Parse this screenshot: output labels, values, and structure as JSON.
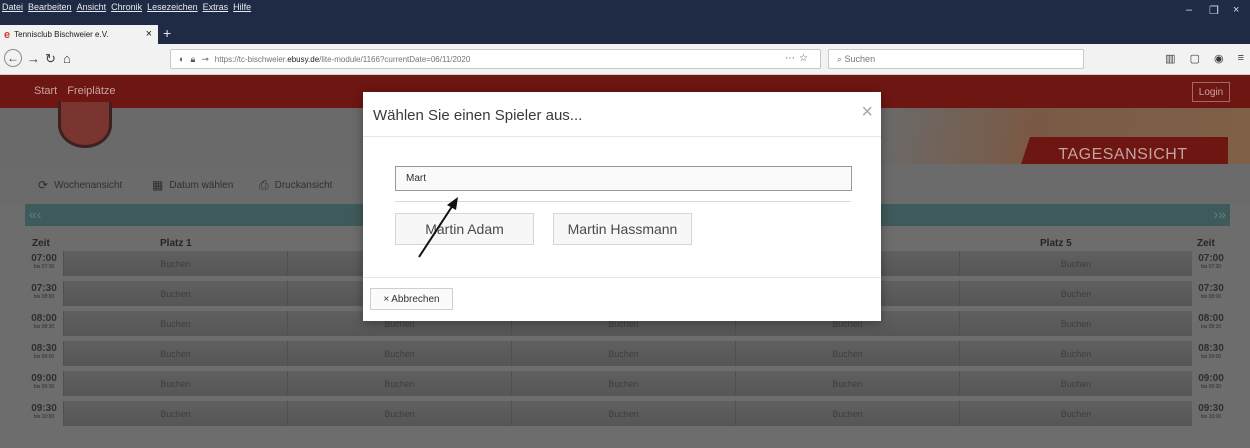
{
  "browser": {
    "menu": [
      "Datei",
      "Bearbeiten",
      "Ansicht",
      "Chronik",
      "Lesezeichen",
      "Extras",
      "Hilfe"
    ],
    "window_controls": [
      "–",
      "❐",
      "×"
    ],
    "tab": {
      "title": "Tennisclub Bischweier e.V.",
      "close": "×"
    },
    "new_tab": "+",
    "url": {
      "prefix": "https://tc-bischweier.",
      "host": "ebusy.de",
      "path": "/lite-module/1166?currentDate=06/11/2020"
    },
    "search_placeholder": "Suchen"
  },
  "site": {
    "nav": [
      "Start",
      "Freiplätze"
    ],
    "login": "Login",
    "view_label": "TAGESANSICHT",
    "tools": {
      "week_view": "Wochenansicht",
      "pick_date": "Datum wählen",
      "print_view": "Druckansicht"
    },
    "prev_arrows": "«‹",
    "next_arrows": "›»",
    "columns": {
      "time": "Zeit",
      "court1": "Platz 1",
      "court5": "Platz 5"
    },
    "slots": [
      {
        "time": "07:00",
        "until": "bis 07:30"
      },
      {
        "time": "07:30",
        "until": "bis 08:00"
      },
      {
        "time": "08:00",
        "until": "bis 08:30"
      },
      {
        "time": "08:30",
        "until": "bis 09:00"
      },
      {
        "time": "09:00",
        "until": "bis 09:30"
      },
      {
        "time": "09:30",
        "until": "bis 10:00"
      }
    ],
    "book_label": "Buchen"
  },
  "modal": {
    "title": "Wählen Sie einen Spieler aus...",
    "search_value": "Mart",
    "players": [
      "Martin Adam",
      "Martin Hassmann"
    ],
    "cancel_label": "Abbrechen",
    "close_label": "×"
  }
}
